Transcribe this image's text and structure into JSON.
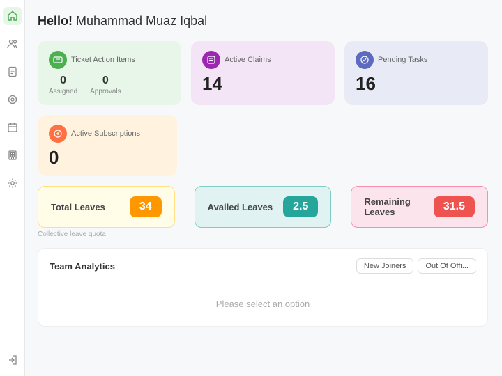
{
  "header": {
    "greeting": "Hello!",
    "username": " Muhammad Muaz Iqbal"
  },
  "sidebar": {
    "items": [
      {
        "name": "home",
        "icon": "🏠",
        "active": true
      },
      {
        "name": "people",
        "icon": "👥",
        "active": false
      },
      {
        "name": "document",
        "icon": "📄",
        "active": false
      },
      {
        "name": "circle",
        "icon": "⊙",
        "active": false
      },
      {
        "name": "calendar",
        "icon": "📅",
        "active": false
      },
      {
        "name": "building",
        "icon": "🏢",
        "active": false
      },
      {
        "name": "settings",
        "icon": "⚙️",
        "active": false
      }
    ],
    "bottom_icon": "↗"
  },
  "cards": {
    "ticket": {
      "title": "Ticket Action Items",
      "assigned_label": "Assigned",
      "approvals_label": "Approvals",
      "assigned_value": "0",
      "approvals_value": "0"
    },
    "claims": {
      "title": "Active Claims",
      "value": "14"
    },
    "pending": {
      "title": "Pending Tasks",
      "value": "16"
    },
    "subscriptions": {
      "title": "Active Subscriptions",
      "value": "0"
    }
  },
  "leaves": {
    "total_label": "Total Leaves",
    "total_value": "34",
    "availed_label": "Availed Leaves",
    "availed_value": "2.5",
    "remaining_label": "Remaining Leaves",
    "remaining_value": "31.5",
    "collective_label": "Collective leave quota"
  },
  "analytics": {
    "title": "Team Analytics",
    "placeholder": "Please select an option",
    "buttons": [
      {
        "label": "New Joiners"
      },
      {
        "label": "Out Of Offi..."
      }
    ]
  }
}
